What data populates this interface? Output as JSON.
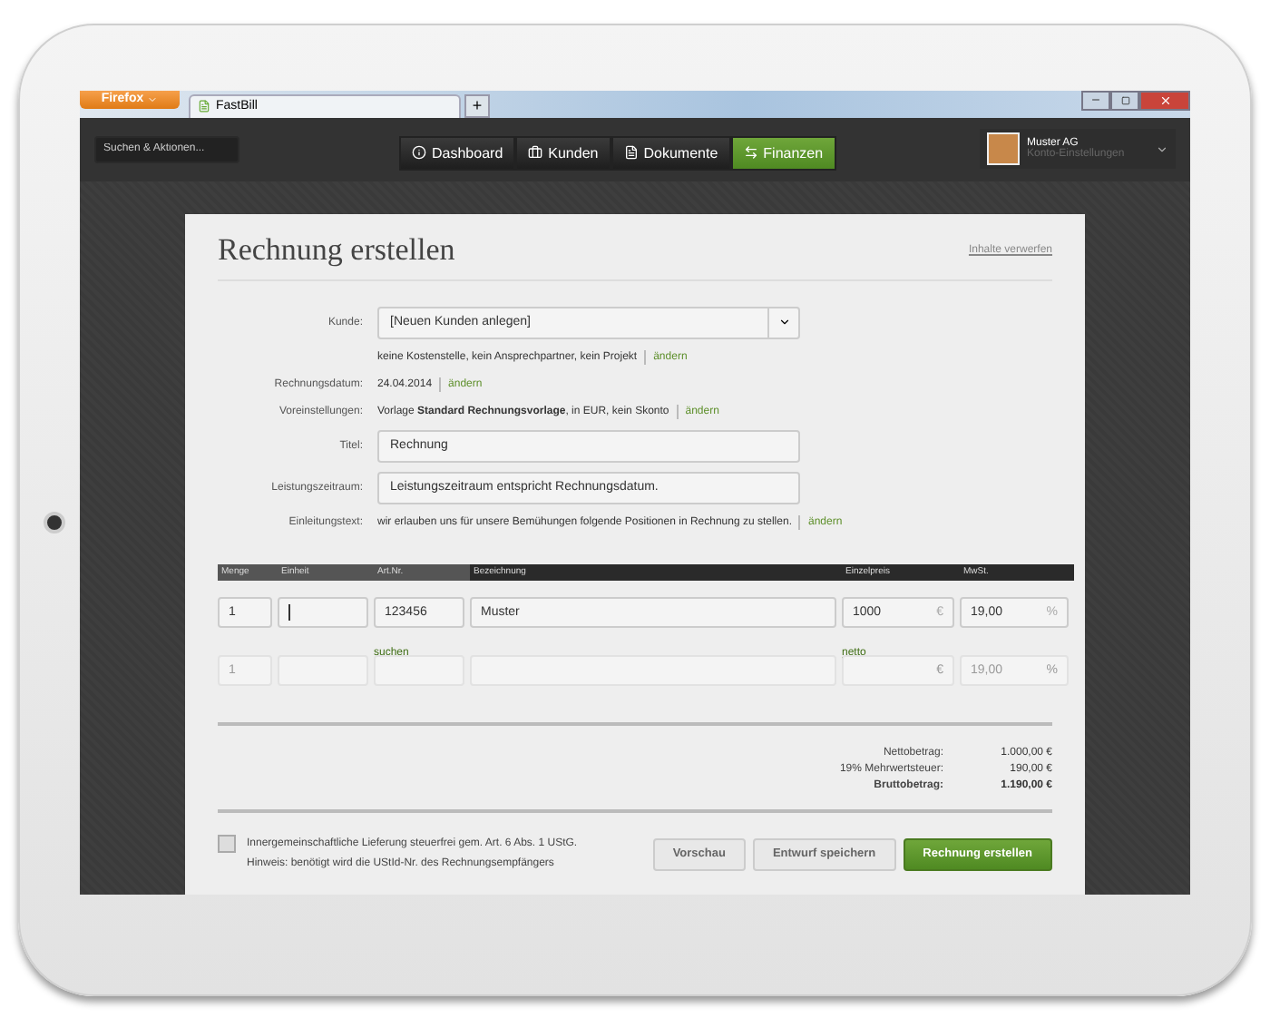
{
  "browser": {
    "menu_button": "Firefox",
    "tab": "FastBill",
    "new_tab": "+"
  },
  "app_header": {
    "search_placeholder": "Suchen & Aktionen...",
    "nav": [
      {
        "label": "Dashboard",
        "selected": false
      },
      {
        "label": "Kunden",
        "selected": false
      },
      {
        "label": "Dokumente",
        "selected": false
      },
      {
        "label": "Finanzen",
        "selected": true
      }
    ],
    "account": {
      "name": "Muster AG",
      "subtitle": "Konto-Einstellungen"
    }
  },
  "form": {
    "title": "Rechnung erstellen",
    "discard_link": "Inhalte verwerfen",
    "fields": [
      {
        "kind": "select",
        "label": "Kunde:",
        "value": "[Neuen Kunden anlegen]"
      },
      {
        "kind": "note",
        "text": "keine Kostenstelle, kein Ansprechpartner, kein Projekt",
        "link": "ändern"
      },
      {
        "kind": "info",
        "label": "Rechnungsdatum:",
        "text": "24.04.2014",
        "link": "ändern"
      },
      {
        "kind": "info",
        "label": "Voreinstellungen:",
        "text": "Vorlage **Standard Rechnungsvorlage**, in EUR, kein Skonto",
        "link": "ändern"
      },
      {
        "kind": "input",
        "label": "Titel:",
        "value": "Rechnung"
      },
      {
        "kind": "input",
        "label": "Leistungszeitraum:",
        "value": "Leistungszeitraum entspricht Rechnungsdatum."
      },
      {
        "kind": "info",
        "label": "Einleitungstext:",
        "text": "wir erlauben uns für unsere Bemühungen folgende Positionen in Rechnung zu stellen.",
        "link": "ändern"
      }
    ],
    "positions": {
      "columns": [
        "Menge",
        "Einheit",
        "Art.Nr.",
        "Bezeichnung",
        "Einzelpreis",
        "MwSt."
      ],
      "rows": [
        {
          "disabled": false,
          "cells": [
            {
              "value": "1",
              "focused": false
            },
            {
              "focused": true
            },
            {
              "value": "123456",
              "focused": false,
              "hint": "suchen"
            },
            {
              "value": "Muster",
              "focused": false
            },
            {
              "value": "1000",
              "unit": "€",
              "focused": false,
              "hint": "netto"
            },
            {
              "value": "19,00",
              "unit": "%",
              "focused": false
            }
          ]
        },
        {
          "disabled": true,
          "cells": [
            {
              "placeholder": "1",
              "focused": false
            },
            {
              "focused": false
            },
            {
              "focused": false
            },
            {
              "focused": false
            },
            {
              "unit": "€",
              "focused": false
            },
            {
              "placeholder": "19,00",
              "unit": "%",
              "focused": false
            }
          ]
        }
      ]
    },
    "totals": [
      {
        "label": "Nettobetrag:",
        "value": "1.000,00 €",
        "bold": false
      },
      {
        "label": "19% Mehrwertsteuer:",
        "value": "190,00 €",
        "bold": false
      },
      {
        "label": "Bruttobetrag:",
        "value": "1.190,00 €",
        "bold": true
      }
    ],
    "tax_option": {
      "checked": false,
      "label": "Innergemeinschaftliche Lieferung steuerfrei gem. Art. 6 Abs. 1 UStG.",
      "hint": "Hinweis: benötigt wird die UStId-Nr. des Rechnungsempfängers"
    },
    "buttons": [
      {
        "label": "Vorschau",
        "kind": "secondary"
      },
      {
        "label": "Entwurf speichern",
        "kind": "secondary"
      },
      {
        "label": "Rechnung erstellen",
        "kind": "primary"
      }
    ]
  }
}
